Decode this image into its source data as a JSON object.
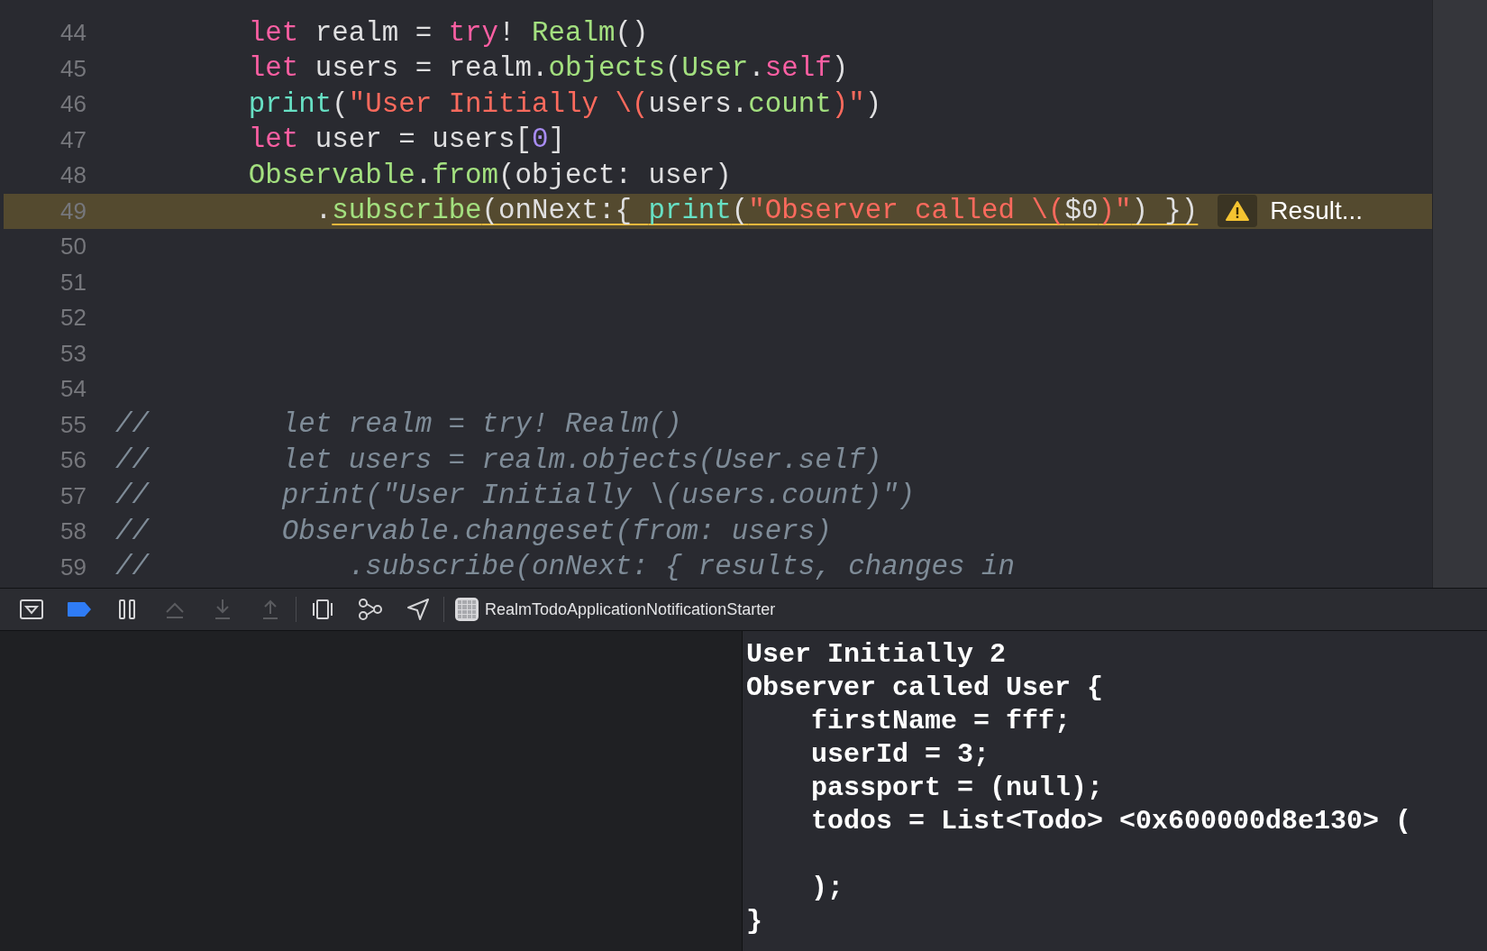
{
  "editor": {
    "lines": [
      {
        "number": "44",
        "highlighted": false,
        "tokens": [
          {
            "text": "        let",
            "kind": "keyword"
          },
          {
            "text": " realm = ",
            "kind": "plain"
          },
          {
            "text": "try",
            "kind": "keyword"
          },
          {
            "text": "! ",
            "kind": "plain"
          },
          {
            "text": "Realm",
            "kind": "type"
          },
          {
            "text": "()",
            "kind": "plain"
          }
        ]
      },
      {
        "number": "45",
        "highlighted": false,
        "tokens": [
          {
            "text": "        let",
            "kind": "keyword"
          },
          {
            "text": " users = realm.",
            "kind": "plain"
          },
          {
            "text": "objects",
            "kind": "type"
          },
          {
            "text": "(",
            "kind": "plain"
          },
          {
            "text": "User",
            "kind": "type"
          },
          {
            "text": ".",
            "kind": "plain"
          },
          {
            "text": "self",
            "kind": "keyword"
          },
          {
            "text": ")",
            "kind": "plain"
          }
        ]
      },
      {
        "number": "46",
        "highlighted": false,
        "tokens": [
          {
            "text": "        print",
            "kind": "func"
          },
          {
            "text": "(",
            "kind": "plain"
          },
          {
            "text": "\"User Initially \\(",
            "kind": "string"
          },
          {
            "text": "users.",
            "kind": "plain"
          },
          {
            "text": "count",
            "kind": "type"
          },
          {
            "text": ")\"",
            "kind": "string"
          },
          {
            "text": ")",
            "kind": "plain"
          }
        ]
      },
      {
        "number": "47",
        "highlighted": false,
        "tokens": [
          {
            "text": "        let",
            "kind": "keyword"
          },
          {
            "text": " user = users[",
            "kind": "plain"
          },
          {
            "text": "0",
            "kind": "number"
          },
          {
            "text": "]",
            "kind": "plain"
          }
        ]
      },
      {
        "number": "48",
        "highlighted": false,
        "tokens": [
          {
            "text": "        Observable",
            "kind": "type"
          },
          {
            "text": ".",
            "kind": "plain"
          },
          {
            "text": "from",
            "kind": "type"
          },
          {
            "text": "(object: user)",
            "kind": "plain"
          }
        ]
      },
      {
        "number": "49",
        "highlighted": true,
        "annotation": "Result...",
        "tokens": [
          {
            "text": "            .",
            "kind": "plain"
          }
        ],
        "warning_tokens": [
          {
            "text": "subscribe",
            "kind": "type"
          },
          {
            "text": "(onNext:{ ",
            "kind": "plain"
          },
          {
            "text": "print",
            "kind": "func"
          },
          {
            "text": "(",
            "kind": "plain"
          },
          {
            "text": "\"Observer called \\(",
            "kind": "string"
          },
          {
            "text": "$0",
            "kind": "plain"
          },
          {
            "text": ")\"",
            "kind": "string"
          },
          {
            "text": ") })",
            "kind": "plain"
          }
        ]
      },
      {
        "number": "50",
        "highlighted": false
      },
      {
        "number": "51",
        "highlighted": false
      },
      {
        "number": "52",
        "highlighted": false
      },
      {
        "number": "53",
        "highlighted": false
      },
      {
        "number": "54",
        "highlighted": false
      },
      {
        "number": "55",
        "highlighted": false,
        "tokens": [
          {
            "text": "//        let realm = try! Realm()",
            "kind": "comment"
          }
        ]
      },
      {
        "number": "56",
        "highlighted": false,
        "tokens": [
          {
            "text": "//        let users = realm.objects(User.self)",
            "kind": "comment"
          }
        ]
      },
      {
        "number": "57",
        "highlighted": false,
        "tokens": [
          {
            "text": "//        print(\"User Initially \\(users.count)\")",
            "kind": "comment"
          }
        ]
      },
      {
        "number": "58",
        "highlighted": false,
        "tokens": [
          {
            "text": "//        Observable.changeset(from: users)",
            "kind": "comment"
          }
        ]
      },
      {
        "number": "59",
        "highlighted": false,
        "tokens": [
          {
            "text": "//            .subscribe(onNext: { results, changes in",
            "kind": "comment"
          }
        ]
      }
    ]
  },
  "debug_bar": {
    "buttons": [
      {
        "kind": "hide",
        "disabled": false
      },
      {
        "kind": "breakpoints",
        "disabled": false
      },
      {
        "kind": "pause",
        "disabled": false
      },
      {
        "kind": "step-over",
        "disabled": true
      },
      {
        "kind": "step-into",
        "disabled": true
      },
      {
        "kind": "step-out",
        "disabled": true
      },
      {
        "kind": "view-debugger",
        "disabled": false
      },
      {
        "kind": "memory-graph",
        "disabled": false
      },
      {
        "kind": "location",
        "disabled": false
      }
    ],
    "target": "RealmTodoApplicationNotificationStarter"
  },
  "console": {
    "output": "User Initially 2\nObserver called User {\n    firstName = fff;\n    userId = 3;\n    passport = (null);\n    todos = List<Todo> <0x600000d8e130> (\n\n    );\n}"
  }
}
